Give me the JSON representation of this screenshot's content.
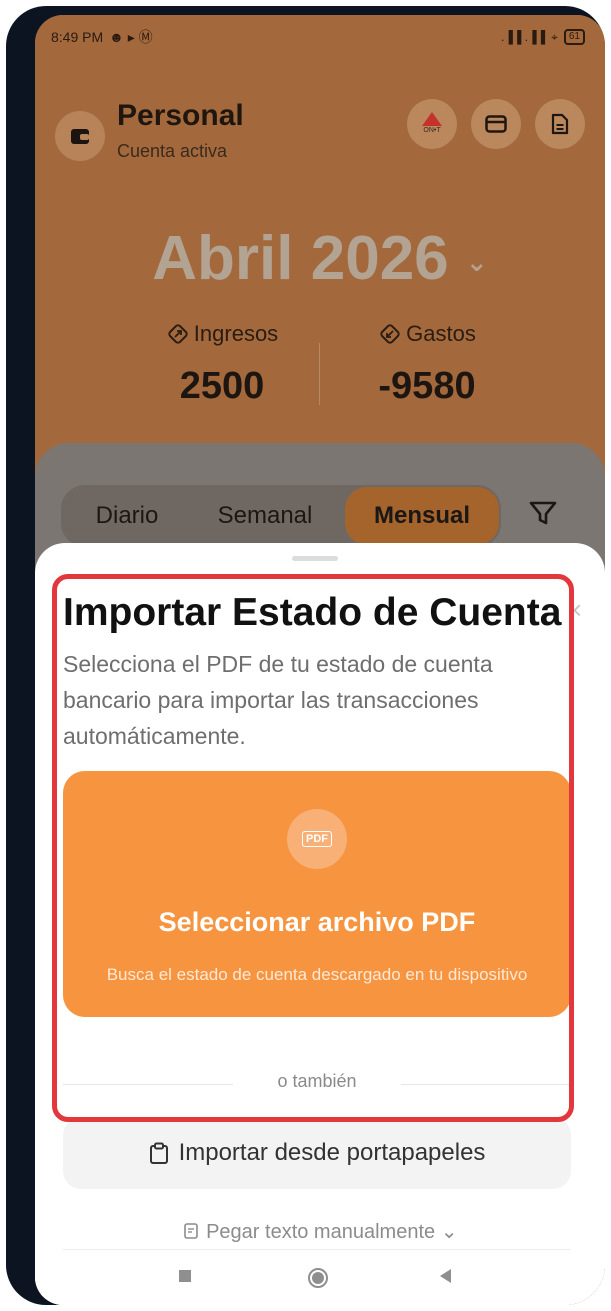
{
  "status_bar": {
    "time": "8:49 PM",
    "left_icons": "☻ ▸ Ⓜ",
    "signal": ".▐▐ .▐▐",
    "wifi": "⌖",
    "battery": "61"
  },
  "account": {
    "name": "Personal",
    "subtitle": "Cuenta activa",
    "icon": "wallet-icon"
  },
  "header_buttons": {
    "brand_badge": "ON•T",
    "card_icon": "credit-card-icon",
    "doc_icon": "document-icon"
  },
  "month": {
    "label": "Abril 2026",
    "chevron": "⌄"
  },
  "summary": {
    "income_label": "Ingresos",
    "income_value": "2500",
    "expense_label": "Gastos",
    "expense_value": "-9580"
  },
  "tabs": [
    "Diario",
    "Semanal",
    "Mensual"
  ],
  "active_tab": "Mensual",
  "sheet": {
    "title": "Importar Estado de Cuenta",
    "close": "×",
    "description": "Selecciona el PDF de tu estado de cuenta bancario para importar las transacciones automáticamente.",
    "pdf_badge": "PDF",
    "pdf_button_title": "Seleccionar archivo PDF",
    "pdf_button_subtitle": "Busca el estado de cuenta descargado en tu dispositivo",
    "or_text": "o también",
    "clipboard_button": "Importar desde portapapeles",
    "manual_paste": "Pegar texto manualmente",
    "manual_chevron": "⌄"
  },
  "colors": {
    "accent_orange": "#f6943f",
    "highlight_red": "#e2373d",
    "sheet_bg": "#ffffff"
  }
}
